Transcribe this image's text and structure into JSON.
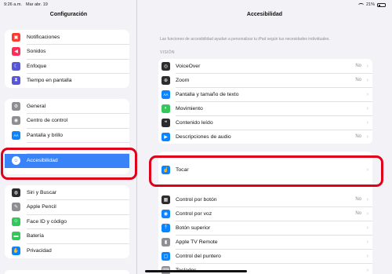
{
  "status": {
    "time": "9:26 a.m.",
    "date": "Mar abr. 19",
    "battery": "21%"
  },
  "sidebar": {
    "title": "Configuración",
    "group1": [
      {
        "label": "Notificaciones",
        "icon": "bell-icon",
        "color": "#ff3b30",
        "glyph": "▣"
      },
      {
        "label": "Sonidos",
        "icon": "speaker-icon",
        "color": "#ff2d55",
        "glyph": "◀"
      },
      {
        "label": "Enfoque",
        "icon": "moon-icon",
        "color": "#5856d6",
        "glyph": "☾"
      },
      {
        "label": "Tiempo en pantalla",
        "icon": "hourglass-icon",
        "color": "#5856d6",
        "glyph": "⧗"
      }
    ],
    "group2": [
      {
        "label": "General",
        "icon": "gear-icon",
        "color": "#8e8e93",
        "glyph": "⚙"
      },
      {
        "label": "Centro de control",
        "icon": "switches-icon",
        "color": "#8e8e93",
        "glyph": "◉"
      },
      {
        "label": "Pantalla y brillo",
        "icon": "text-size-icon",
        "color": "#0a84ff",
        "glyph": "AA"
      },
      {
        "label": "Accesibilidad",
        "icon": "accessibility-icon",
        "color": "#0a84ff",
        "glyph": "☺",
        "selected": true
      }
    ],
    "group3": [
      {
        "label": "Siri y Buscar",
        "icon": "siri-icon",
        "color": "#2c2c2e",
        "glyph": "◍"
      },
      {
        "label": "Apple Pencil",
        "icon": "pencil-icon",
        "color": "#8e8e93",
        "glyph": "✎"
      },
      {
        "label": "Face ID y código",
        "icon": "faceid-icon",
        "color": "#34c759",
        "glyph": "☺"
      },
      {
        "label": "Batería",
        "icon": "battery-icon",
        "color": "#34c759",
        "glyph": "▬"
      },
      {
        "label": "Privacidad",
        "icon": "hand-icon",
        "color": "#0a84ff",
        "glyph": "✋"
      }
    ]
  },
  "main": {
    "title": "Accesibilidad",
    "description": "Las funciones de accesibilidad ayudan a personalizar tu iPad según tus necesidades individuales.",
    "section_vision": "VISIÓN",
    "vision_items": [
      {
        "label": "VoiceOver",
        "value": "No",
        "icon": "voiceover-icon",
        "color": "#2c2c2e",
        "glyph": "◎"
      },
      {
        "label": "Zoom",
        "value": "No",
        "icon": "zoom-icon",
        "color": "#2c2c2e",
        "glyph": "⊕"
      },
      {
        "label": "Pantalla y tamaño de texto",
        "value": "",
        "icon": "text-size-icon",
        "color": "#0a84ff",
        "glyph": "AA"
      },
      {
        "label": "Movimiento",
        "value": "",
        "icon": "motion-icon",
        "color": "#34c759",
        "glyph": "◐"
      },
      {
        "label": "Contenido leído",
        "value": "",
        "icon": "speech-icon",
        "color": "#2c2c2e",
        "glyph": "❝"
      },
      {
        "label": "Descripciones de audio",
        "value": "No",
        "icon": "audio-description-icon",
        "color": "#0a84ff",
        "glyph": "▶"
      }
    ],
    "touch_item": {
      "label": "Tocar",
      "icon": "touch-hand-icon",
      "color": "#0a84ff",
      "glyph": "☝"
    },
    "interaction_items": [
      {
        "label": "Control por botón",
        "value": "No",
        "icon": "switch-control-icon",
        "color": "#2c2c2e",
        "glyph": "▦"
      },
      {
        "label": "Control por voz",
        "value": "No",
        "icon": "voice-control-icon",
        "color": "#0a84ff",
        "glyph": "◉"
      },
      {
        "label": "Botón superior",
        "value": "",
        "icon": "top-button-icon",
        "color": "#0a84ff",
        "glyph": "⤒"
      },
      {
        "label": "Apple TV Remote",
        "value": "",
        "icon": "remote-icon",
        "color": "#8e8e93",
        "glyph": "▮"
      },
      {
        "label": "Control del puntero",
        "value": "",
        "icon": "pointer-icon",
        "color": "#0a84ff",
        "glyph": "▢"
      },
      {
        "label": "Teclados",
        "value": "",
        "icon": "keyboard-icon",
        "color": "#8e8e93",
        "glyph": "⌨"
      }
    ]
  }
}
